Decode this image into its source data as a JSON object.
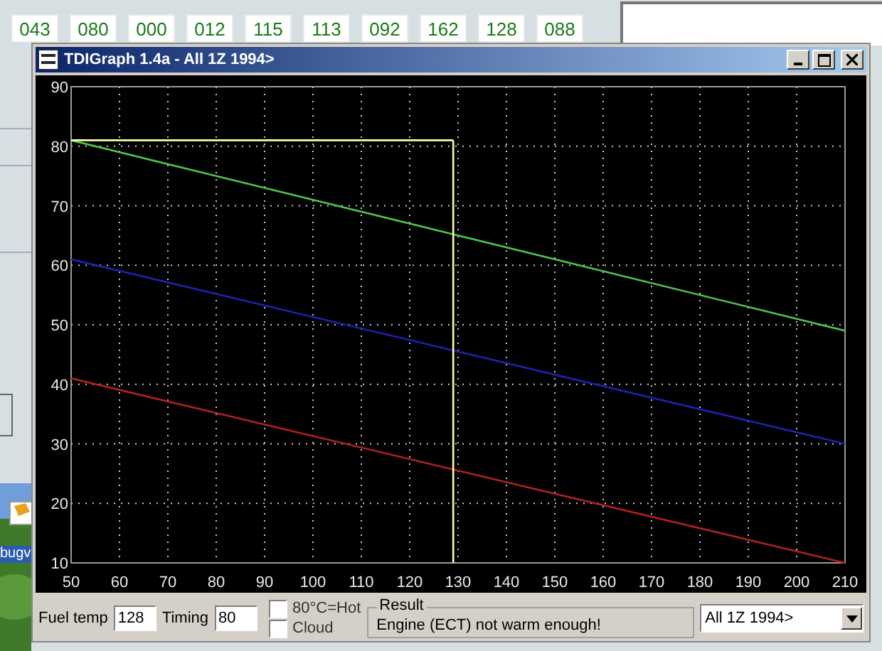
{
  "readouts": [
    "043",
    "080",
    "000",
    "012",
    "115",
    "113",
    "092",
    "162",
    "128",
    "088"
  ],
  "desktop": {
    "icon_label": "bugv"
  },
  "window": {
    "title": "TDIGraph 1.4a - All 1Z 1994>",
    "chart_data": {
      "type": "line",
      "x": [
        50,
        210
      ],
      "series": [
        {
          "color": "#4fc04f",
          "values": [
            81,
            49
          ]
        },
        {
          "color": "#2020b0",
          "values": [
            61,
            30
          ]
        },
        {
          "color": "#b02020",
          "values": [
            41,
            10
          ]
        }
      ],
      "grid": true,
      "xlim": [
        50,
        210
      ],
      "ylim": [
        10,
        90
      ],
      "xticks": [
        50,
        60,
        70,
        80,
        90,
        100,
        110,
        120,
        130,
        140,
        150,
        160,
        170,
        180,
        190,
        200,
        210
      ],
      "yticks": [
        10,
        20,
        30,
        40,
        50,
        60,
        70,
        80,
        90
      ],
      "ref_lines": [
        {
          "axis": "x",
          "value": 129,
          "color": "#ffffa0"
        },
        {
          "axis": "y",
          "value": 81,
          "color": "#ffffa0"
        }
      ]
    },
    "fuel_temp": {
      "label": "Fuel temp",
      "value": "128"
    },
    "timing": {
      "label": "Timing",
      "value": "80"
    },
    "options": [
      {
        "label": "80°C=Hot",
        "checked": false
      },
      {
        "label": "Cloud",
        "checked": false
      }
    ],
    "result": {
      "title": "Result",
      "message": "Engine (ECT) not warm enough!"
    },
    "model_select": {
      "value": "All 1Z 1994>"
    }
  }
}
